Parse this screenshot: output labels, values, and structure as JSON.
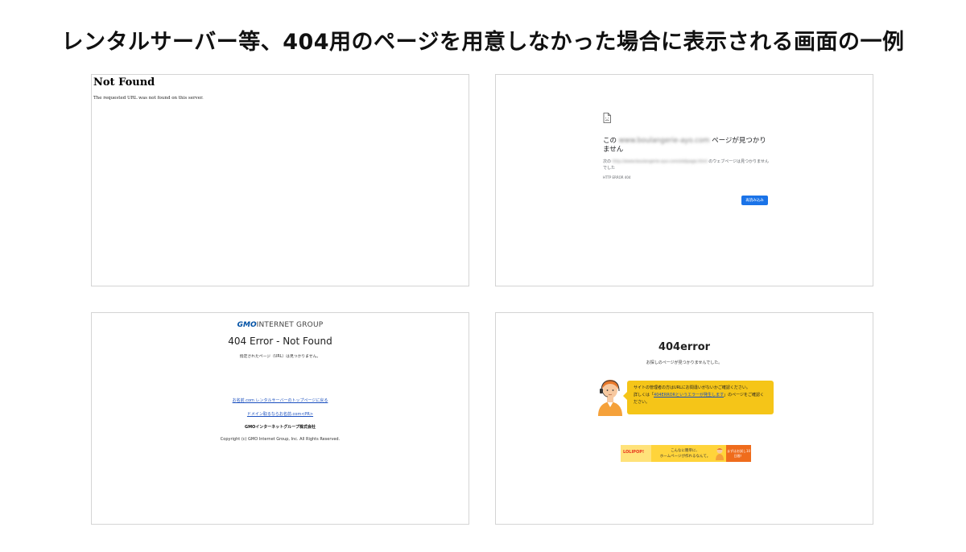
{
  "title": "レンタルサーバー等、404用のページを用意しなかった場合に表示される画面の一例",
  "panel1": {
    "heading": "Not Found",
    "text": "The requested URL was not found on this server."
  },
  "panel2": {
    "icon": "broken-page-icon",
    "heading_prefix": "この",
    "heading_blurred": "www.boulangerie-ayo.com",
    "heading_suffix": "ページが見つかりません",
    "sub_prefix": "次の",
    "sub_blurred": "http://www.boulangerie-ayo.com/old/page.html",
    "sub_suffix": "のウェブページは見つかりませんでした",
    "error_code": "HTTP ERROR 404",
    "reload_button": "再読み込み",
    "accent_color": "#1a73e8"
  },
  "panel3": {
    "logo_bold": "GMO",
    "logo_rest": "INTERNET GROUP",
    "heading": "404 Error - Not Found",
    "subtext": "指定されたページ（URL）は見つかりません。",
    "link1": "お名前.com レンタルサーバーのトップページに戻る",
    "link2": "ドメイン取るならお名前.com<PR>",
    "company": "GMOインターネットグループ株式会社",
    "copyright": "Copyright (c) GMO Internet Group, Inc. All Rights Reserved."
  },
  "panel4": {
    "heading": "404error",
    "subtext": "お探しのページが見つかりませんでした。",
    "bubble_line1": "サイトの管理者の方はURLにお間違いがないかご確認ください。",
    "bubble_prefix": "詳しくは「",
    "bubble_link": "404ERRORというエラーが発生します",
    "bubble_suffix": "」のページをご確認ください。",
    "banner_logo": "LOLIPOP!",
    "banner_line1": "こんなに簡単に、",
    "banner_line2": "ホームページが作れるなんて。",
    "banner_cta": "まずはお試し10日間！",
    "accent_color": "#f5c518"
  }
}
